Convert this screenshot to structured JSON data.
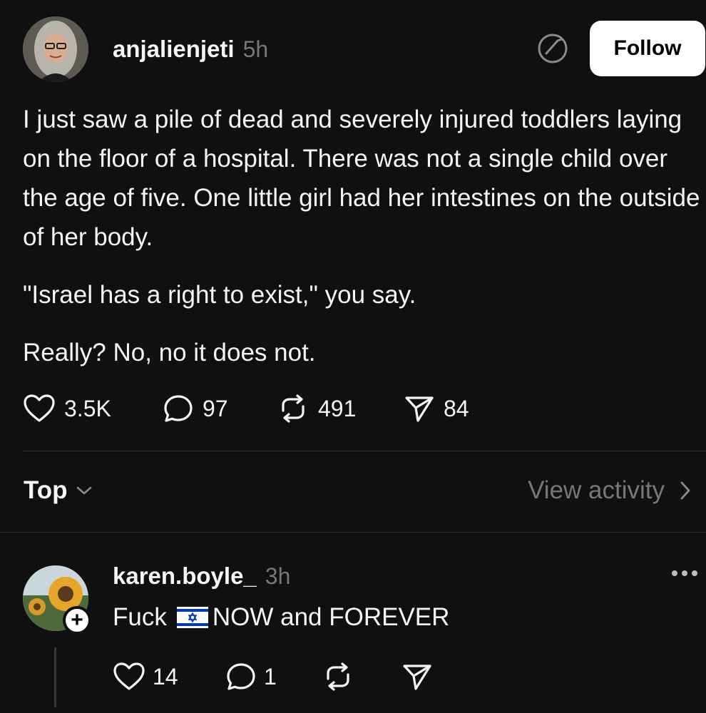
{
  "post": {
    "username": "anjalienjeti",
    "time": "5h",
    "follow_label": "Follow",
    "paragraphs": [
      "I just saw a pile of dead and severely injured toddlers laying on the floor of a hospital. There was not a single child over the age of five. One little girl had her intestines on the outside of her body.",
      "\"Israel has a right to exist,\" you say.",
      "Really? No, no it does not."
    ],
    "likes": "3.5K",
    "comments": "97",
    "reposts": "491",
    "shares": "84"
  },
  "sort": {
    "label": "Top",
    "view_activity": "View activity"
  },
  "reply": {
    "username": "karen.boyle_",
    "time": "3h",
    "text_before": "Fuck",
    "text_after": "NOW and FOREVER",
    "flag_icon": "israel-flag-icon",
    "likes": "14",
    "comments": "1"
  },
  "colors": {
    "background": "#101010",
    "text": "#f3f5f7",
    "muted": "#777777",
    "divider": "#2d2d2d",
    "flag_blue": "#0038b8"
  }
}
